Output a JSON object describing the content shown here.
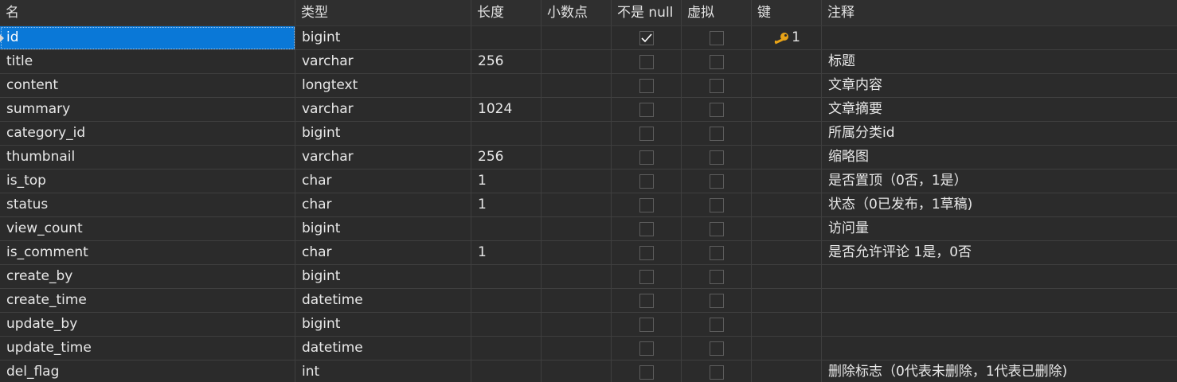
{
  "columns": {
    "name": "名",
    "type": "类型",
    "length": "长度",
    "decimals": "小数点",
    "not_null": "不是 null",
    "virtual": "虚拟",
    "key": "键",
    "comment": "注释"
  },
  "rows": [
    {
      "name": "id",
      "type": "bigint",
      "length": "",
      "not_null": true,
      "virtual": false,
      "key": "1",
      "comment": ""
    },
    {
      "name": "title",
      "type": "varchar",
      "length": "256",
      "not_null": false,
      "virtual": false,
      "key": "",
      "comment": "标题"
    },
    {
      "name": "content",
      "type": "longtext",
      "length": "",
      "not_null": false,
      "virtual": false,
      "key": "",
      "comment": "文章内容"
    },
    {
      "name": "summary",
      "type": "varchar",
      "length": "1024",
      "not_null": false,
      "virtual": false,
      "key": "",
      "comment": "文章摘要"
    },
    {
      "name": "category_id",
      "type": "bigint",
      "length": "",
      "not_null": false,
      "virtual": false,
      "key": "",
      "comment": "所属分类id"
    },
    {
      "name": "thumbnail",
      "type": "varchar",
      "length": "256",
      "not_null": false,
      "virtual": false,
      "key": "",
      "comment": "缩略图"
    },
    {
      "name": "is_top",
      "type": "char",
      "length": "1",
      "not_null": false,
      "virtual": false,
      "key": "",
      "comment": "是否置顶（0否，1是）"
    },
    {
      "name": "status",
      "type": "char",
      "length": "1",
      "not_null": false,
      "virtual": false,
      "key": "",
      "comment": "状态（0已发布，1草稿)"
    },
    {
      "name": "view_count",
      "type": "bigint",
      "length": "",
      "not_null": false,
      "virtual": false,
      "key": "",
      "comment": "访问量"
    },
    {
      "name": "is_comment",
      "type": "char",
      "length": "1",
      "not_null": false,
      "virtual": false,
      "key": "",
      "comment": "是否允许评论 1是，0否"
    },
    {
      "name": "create_by",
      "type": "bigint",
      "length": "",
      "not_null": false,
      "virtual": false,
      "key": "",
      "comment": ""
    },
    {
      "name": "create_time",
      "type": "datetime",
      "length": "",
      "not_null": false,
      "virtual": false,
      "key": "",
      "comment": ""
    },
    {
      "name": "update_by",
      "type": "bigint",
      "length": "",
      "not_null": false,
      "virtual": false,
      "key": "",
      "comment": ""
    },
    {
      "name": "update_time",
      "type": "datetime",
      "length": "",
      "not_null": false,
      "virtual": false,
      "key": "",
      "comment": ""
    },
    {
      "name": "del_flag",
      "type": "int",
      "length": "",
      "not_null": false,
      "virtual": false,
      "key": "",
      "comment": "删除标志（0代表未删除，1代表已删除)"
    }
  ],
  "selected_row": 0,
  "colors": {
    "background": "#2b2b2b",
    "selection": "#0a78d7",
    "key_icon": "#e8a317",
    "grid": "#3f3f3f"
  },
  "icons": {
    "primary_key": "key-icon",
    "not_null_checked": "checkmark-icon",
    "row_pointer": "row-marker-icon"
  }
}
